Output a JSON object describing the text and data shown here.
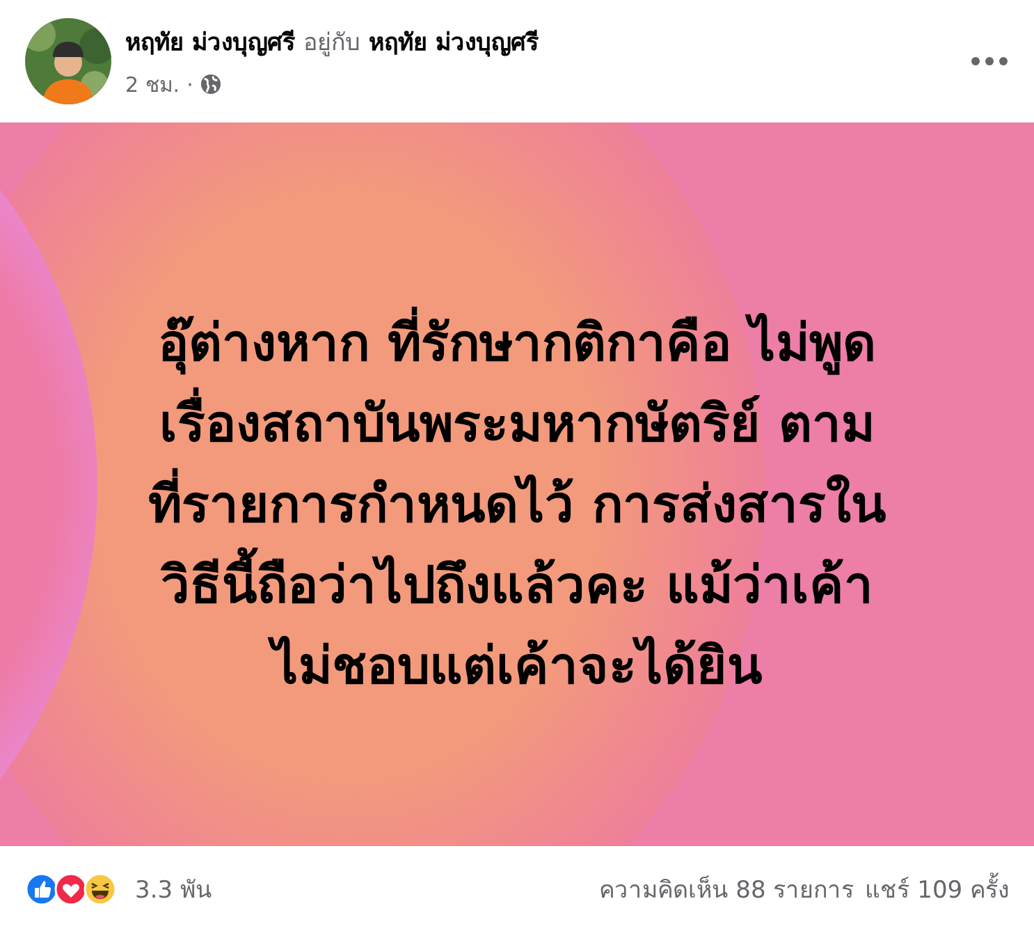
{
  "post": {
    "author": "หฤทัย ม่วงบุญศรี",
    "with_label": "อยู่กับ",
    "with_name": "หฤทัย ม่วงบุญศรี",
    "time": "2 ชม.",
    "separator": "·",
    "text_lines": [
      "อุ๊ต่างหาก ที่รักษากติกาคือ ไม่พูด",
      "เรื่องสถาบันพระมหากษัตริย์ ตาม",
      "ที่รายการกำหนดไว้ การส่งสารใน",
      "วิธีนี้ถือว่าไปถึงแล้วคะ แม้ว่าเค้า",
      "ไม่ชอบแต่เค้าจะได้ยิน"
    ]
  },
  "footer": {
    "reactions": [
      {
        "kind": "like"
      },
      {
        "kind": "love"
      },
      {
        "kind": "haha"
      }
    ],
    "reaction_count": "3.3 พัน",
    "comments": "ความคิดเห็น 88 รายการ",
    "shares": "แชร์ 109 ครั้ง"
  }
}
